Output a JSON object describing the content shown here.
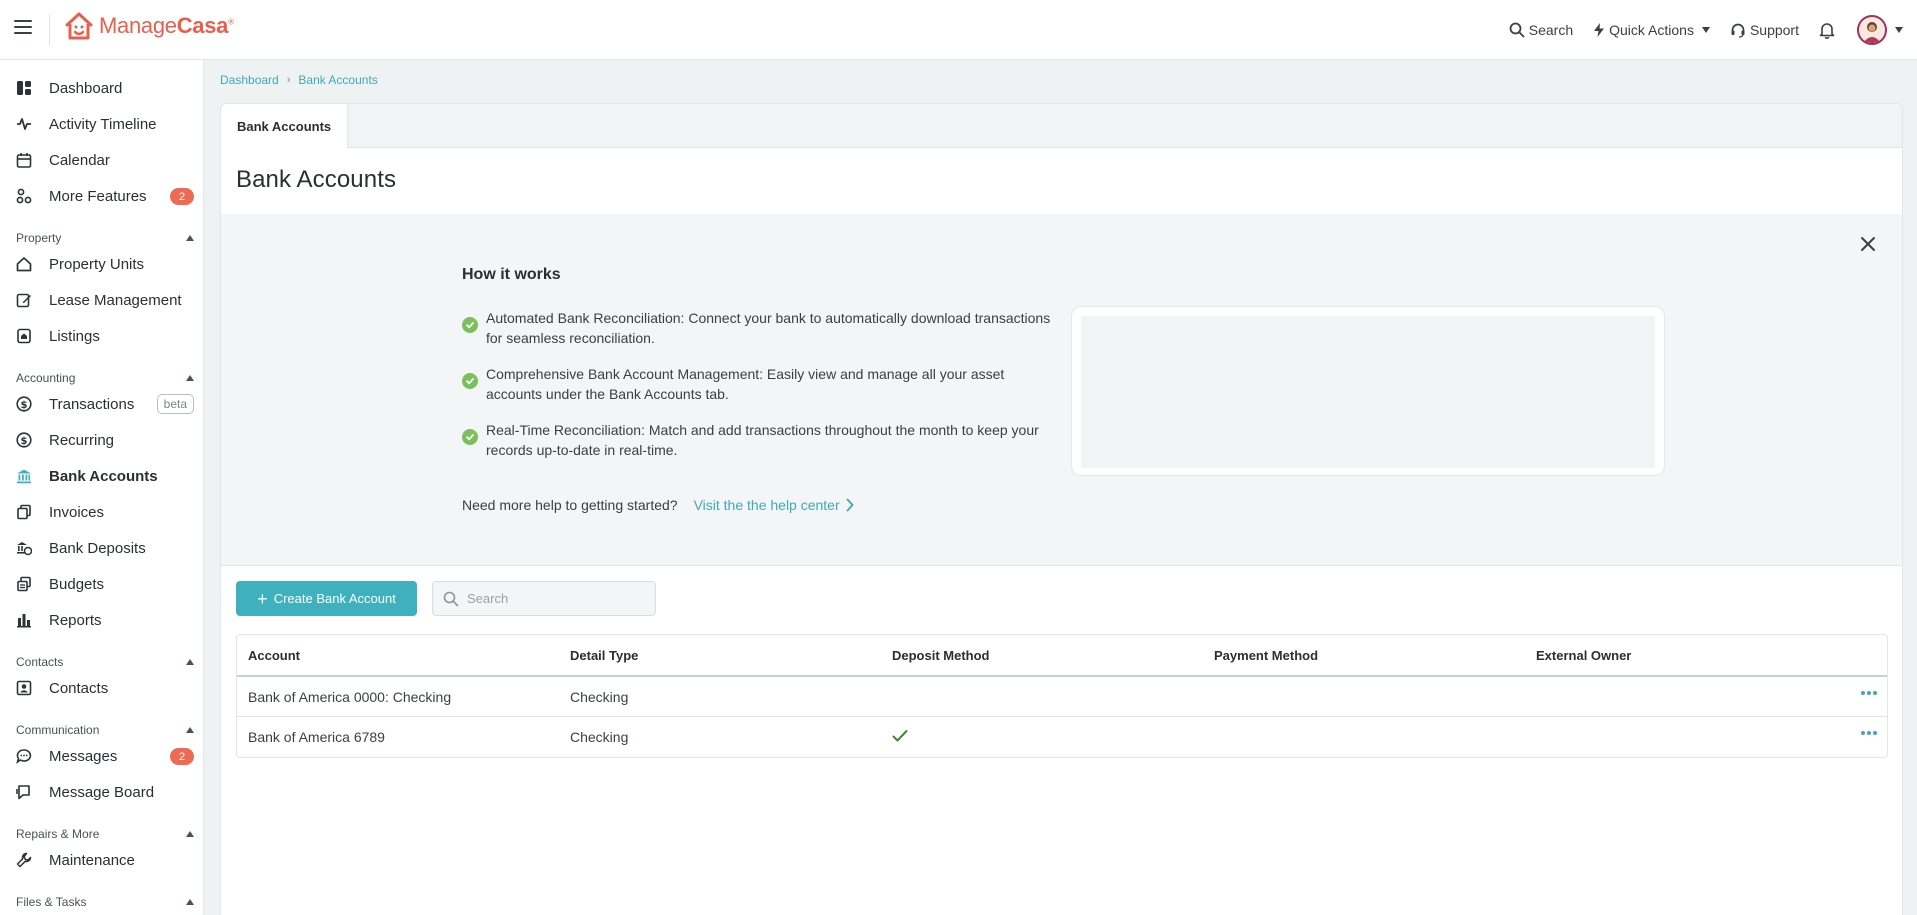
{
  "app": {
    "brand_light": "Manage",
    "brand_bold": "Casa",
    "brand_reg": "®",
    "accent_color": "#3fb1be",
    "brand_color": "#e8604c"
  },
  "topbar": {
    "search_label": "Search",
    "quick_actions_label": "Quick Actions",
    "support_label": "Support"
  },
  "sidebar": {
    "items_top": [
      {
        "label": "Dashboard",
        "icon": "dashboard-icon"
      },
      {
        "label": "Activity Timeline",
        "icon": "activity-icon"
      },
      {
        "label": "Calendar",
        "icon": "calendar-icon"
      },
      {
        "label": "More Features",
        "icon": "features-icon",
        "badge": "2"
      }
    ],
    "sections": {
      "property": "Property",
      "accounting": "Accounting",
      "contacts": "Contacts",
      "communication": "Communication",
      "repairs": "Repairs & More",
      "files": "Files & Tasks"
    },
    "property_items": [
      "Property Units",
      "Lease Management",
      "Listings"
    ],
    "accounting_items": [
      "Transactions",
      "Recurring",
      "Bank Accounts",
      "Invoices",
      "Bank Deposits",
      "Budgets",
      "Reports"
    ],
    "transactions_tag": "beta",
    "contacts_items": [
      "Contacts"
    ],
    "communication_items": [
      "Messages",
      "Message Board"
    ],
    "messages_badge": "2",
    "repairs_items": [
      "Maintenance"
    ],
    "active_item": "Bank Accounts"
  },
  "breadcrumb": {
    "items": [
      "Dashboard",
      "Bank Accounts"
    ]
  },
  "main": {
    "tab_label": "Bank Accounts",
    "title": "Bank Accounts",
    "how_it_works": {
      "title": "How it works",
      "points": [
        "Automated Bank Reconciliation: Connect your bank to automatically download transactions for seamless reconciliation.",
        "Comprehensive Bank Account Management: Easily view and manage all your asset accounts under the Bank Accounts tab.",
        "Real-Time Reconciliation: Match and add transactions throughout the month to keep your records up-to-date in real-time."
      ],
      "help_question": "Need more help to getting started?",
      "help_link": "Visit the the help center"
    },
    "create_button": "Create Bank Account",
    "search_placeholder": "Search",
    "table": {
      "columns": [
        "Account",
        "Detail Type",
        "Deposit Method",
        "Payment Method",
        "External Owner"
      ],
      "rows": [
        {
          "account": "Bank of America 0000: Checking",
          "detail_type": "Checking",
          "deposit_method": false,
          "payment_method": "",
          "external_owner": ""
        },
        {
          "account": "Bank of America 6789",
          "detail_type": "Checking",
          "deposit_method": true,
          "payment_method": "",
          "external_owner": ""
        }
      ]
    }
  }
}
